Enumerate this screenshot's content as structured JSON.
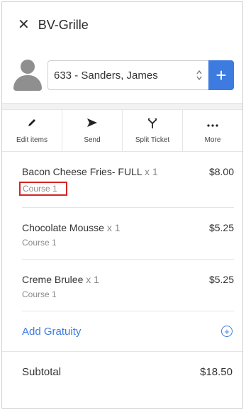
{
  "header": {
    "title": "BV-Grille",
    "close_glyph": "✕"
  },
  "customer": {
    "selected": "633 - Sanders, James",
    "add_glyph": "+"
  },
  "toolbar": {
    "items": [
      {
        "label": "Edit items",
        "icon": "pencil-icon"
      },
      {
        "label": "Send",
        "icon": "send-icon"
      },
      {
        "label": "Split Ticket",
        "icon": "split-icon"
      },
      {
        "label": "More",
        "icon": "more-icon"
      }
    ]
  },
  "order": {
    "items": [
      {
        "name": "Bacon Cheese Fries- FULL",
        "qty": "x 1",
        "price": "$8.00",
        "course": "Course 1"
      },
      {
        "name": "Chocolate Mousse",
        "qty": "x 1",
        "price": "$5.25",
        "course": "Course 1"
      },
      {
        "name": "Creme Brulee",
        "qty": "x 1",
        "price": "$5.25",
        "course": "Course 1"
      }
    ]
  },
  "gratuity": {
    "label": "Add Gratuity"
  },
  "subtotal": {
    "label": "Subtotal",
    "value": "$18.50"
  },
  "colors": {
    "accent": "#3d7be0",
    "highlight": "#d62424"
  }
}
